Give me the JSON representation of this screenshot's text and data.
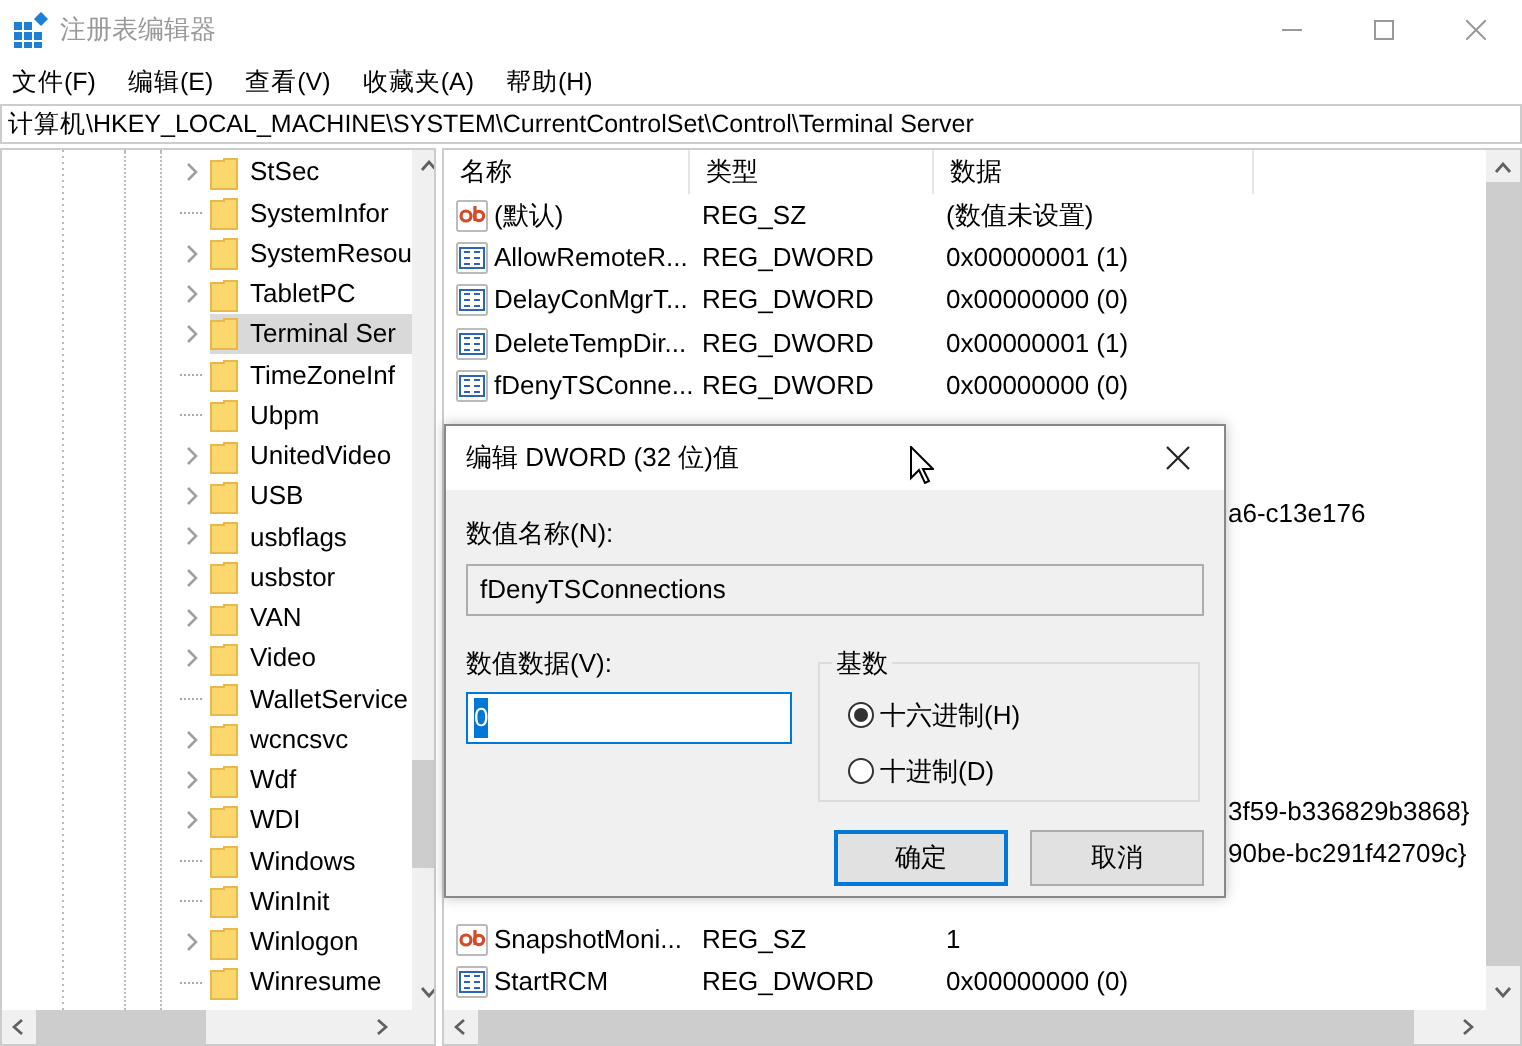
{
  "window": {
    "title": "注册表编辑器"
  },
  "menu": [
    "文件(F)",
    "编辑(E)",
    "查看(V)",
    "收藏夹(A)",
    "帮助(H)"
  ],
  "address": "计算机\\HKEY_LOCAL_MACHINE\\SYSTEM\\CurrentControlSet\\Control\\Terminal Server",
  "tree": {
    "items": [
      {
        "label": "StSec",
        "expandable": true,
        "selected": false
      },
      {
        "label": "SystemInfor",
        "expandable": false,
        "selected": false
      },
      {
        "label": "SystemResou",
        "expandable": true,
        "selected": false
      },
      {
        "label": "TabletPC",
        "expandable": true,
        "selected": false
      },
      {
        "label": "Terminal Ser",
        "expandable": true,
        "selected": true
      },
      {
        "label": "TimeZoneInf",
        "expandable": false,
        "selected": false
      },
      {
        "label": "Ubpm",
        "expandable": false,
        "selected": false
      },
      {
        "label": "UnitedVideo",
        "expandable": true,
        "selected": false
      },
      {
        "label": "USB",
        "expandable": true,
        "selected": false
      },
      {
        "label": "usbflags",
        "expandable": true,
        "selected": false
      },
      {
        "label": "usbstor",
        "expandable": true,
        "selected": false
      },
      {
        "label": "VAN",
        "expandable": true,
        "selected": false
      },
      {
        "label": "Video",
        "expandable": true,
        "selected": false
      },
      {
        "label": "WalletService",
        "expandable": false,
        "selected": false
      },
      {
        "label": "wcncsvc",
        "expandable": true,
        "selected": false
      },
      {
        "label": "Wdf",
        "expandable": true,
        "selected": false
      },
      {
        "label": "WDI",
        "expandable": true,
        "selected": false
      },
      {
        "label": "Windows",
        "expandable": false,
        "selected": false
      },
      {
        "label": "WinInit",
        "expandable": false,
        "selected": false
      },
      {
        "label": "Winlogon",
        "expandable": true,
        "selected": false
      },
      {
        "label": "Winresume",
        "expandable": false,
        "selected": false
      }
    ]
  },
  "table": {
    "columns": [
      "名称",
      "类型",
      "数据"
    ],
    "rows": [
      {
        "kind": "string",
        "name": "(默认)",
        "type": "REG_SZ",
        "data": "(数值未设置)"
      },
      {
        "kind": "dword",
        "name": "AllowRemoteR...",
        "type": "REG_DWORD",
        "data": "0x00000001 (1)"
      },
      {
        "kind": "dword",
        "name": "DelayConMgrT...",
        "type": "REG_DWORD",
        "data": "0x00000000 (0)"
      },
      {
        "kind": "dword",
        "name": "DeleteTempDir...",
        "type": "REG_DWORD",
        "data": "0x00000001 (1)"
      },
      {
        "kind": "dword",
        "name": "fDenyTSConne...",
        "type": "REG_DWORD",
        "data": "0x00000000 (0)"
      },
      {
        "kind": "covered"
      },
      {
        "kind": "covered"
      },
      {
        "kind": "cut",
        "data": "a6-c13e176"
      },
      {
        "kind": "covered"
      },
      {
        "kind": "covered"
      },
      {
        "kind": "covered"
      },
      {
        "kind": "covered"
      },
      {
        "kind": "covered"
      },
      {
        "kind": "covered"
      },
      {
        "kind": "cut",
        "data": "3f59-b336829b3868}"
      },
      {
        "kind": "cut",
        "data": "90be-bc291f42709c}"
      },
      {
        "kind": "covered"
      },
      {
        "kind": "string",
        "name": "SnapshotMoni...",
        "type": "REG_SZ",
        "data": "1"
      },
      {
        "kind": "dword",
        "name": "StartRCM",
        "type": "REG_DWORD",
        "data": "0x00000000 (0)"
      }
    ]
  },
  "dialog": {
    "title": "编辑 DWORD (32 位)值",
    "name_label": "数值名称(N):",
    "name_value": "fDenyTSConnections",
    "data_label": "数值数据(V):",
    "data_value": "0",
    "base": {
      "title": "基数",
      "options": [
        {
          "label": "十六进制(H)",
          "selected": true
        },
        {
          "label": "十进制(D)",
          "selected": false
        }
      ]
    },
    "buttons": [
      {
        "label": "确定",
        "default": true
      },
      {
        "label": "取消",
        "default": false
      }
    ]
  }
}
